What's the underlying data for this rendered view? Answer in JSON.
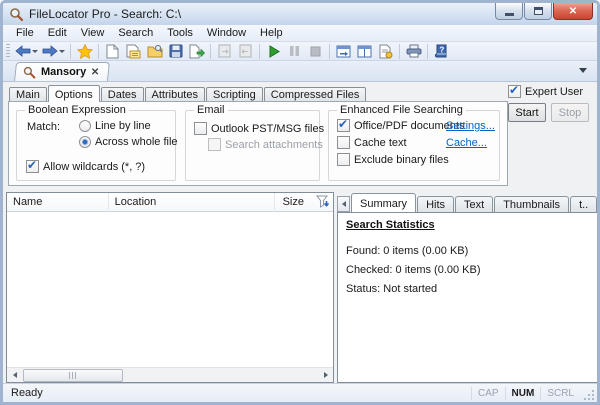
{
  "window": {
    "title": "FileLocator Pro - Search: C:\\",
    "controls": {
      "minimize": "minimize",
      "maximize": "maximize",
      "close": "close"
    }
  },
  "menu": {
    "items": [
      "File",
      "Edit",
      "View",
      "Search",
      "Tools",
      "Window",
      "Help"
    ]
  },
  "toolbar": {
    "icons": [
      "back",
      "forward",
      "favorites",
      "new-search",
      "edit-criteria",
      "open",
      "save",
      "export",
      "send-results-disabled",
      "import-results-disabled",
      "start-search",
      "pause-search-disabled",
      "stop-search-disabled",
      "layout-horizontal",
      "layout-vertical",
      "report-options",
      "print",
      "help"
    ]
  },
  "document_tabs": {
    "active_label": "Mansory",
    "close_glyph": "✕"
  },
  "search_tabs": {
    "items": [
      "Main",
      "Options",
      "Dates",
      "Attributes",
      "Scripting",
      "Compressed Files"
    ],
    "active": "Options"
  },
  "expert_user": {
    "label": "Expert User",
    "checked": true
  },
  "actions": {
    "start": "Start",
    "stop": "Stop"
  },
  "options_page": {
    "boolean_expression": {
      "title": "Boolean Expression",
      "match_label": "Match:",
      "radio_line": "Line by line",
      "radio_whole": "Across whole file",
      "selected_radio": "Across whole file",
      "wildcards_label": "Allow wildcards (*, ?)",
      "wildcards_checked": true
    },
    "email": {
      "title": "Email",
      "outlook_label": "Outlook PST/MSG files",
      "outlook_checked": false,
      "attachments_label": "Search attachments",
      "attachments_enabled": false
    },
    "enhanced": {
      "title": "Enhanced File Searching",
      "office_label": "Office/PDF documents",
      "office_checked": true,
      "settings_link": "Settings...",
      "cache_text_label": "Cache text",
      "cache_text_checked": false,
      "cache_link": "Cache...",
      "exclude_label": "Exclude binary files",
      "exclude_checked": false
    }
  },
  "results_list": {
    "columns": [
      "Name",
      "Location",
      "Size"
    ]
  },
  "preview_tabs": {
    "items": [
      "Summary",
      "Hits",
      "Text",
      "Thumbnails",
      "t.."
    ],
    "active": "Summary"
  },
  "summary_panel": {
    "heading": "Search Statistics",
    "found": "Found: 0 items (0.00 KB)",
    "checked": "Checked: 0 items (0.00 KB)",
    "status": "Status: Not started"
  },
  "status_bar": {
    "ready": "Ready",
    "cap": "CAP",
    "num": "NUM",
    "scrl": "SCRL",
    "active_indicator": "NUM"
  },
  "colors": {
    "accent_link": "#0563c1",
    "close_button": "#c8442f",
    "check": "#2a62bc",
    "star": "#ffc20e",
    "play": "#2e9e2e"
  }
}
